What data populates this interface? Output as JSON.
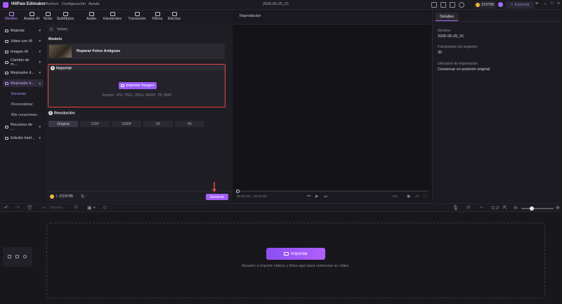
{
  "app": {
    "name": "HitPaw Edimakor",
    "date_title": "2026-05-25_01",
    "coins": "219795",
    "export_label": "Exportar"
  },
  "menu": [
    "Archivo",
    "Configuración",
    "Ayuda"
  ],
  "toolbar": [
    {
      "label": "Medios",
      "icon": "media-icon",
      "active": true
    },
    {
      "label": "Avatar AI",
      "icon": "avatar-icon"
    },
    {
      "label": "Texto",
      "icon": "text-icon"
    },
    {
      "label": "Subtítulos",
      "icon": "subtitles-icon"
    },
    {
      "label": "Audio",
      "icon": "audio-icon"
    },
    {
      "label": "Elementos",
      "icon": "elements-icon"
    },
    {
      "label": "Transición",
      "icon": "transition-icon"
    },
    {
      "label": "Filtros",
      "icon": "filters-icon"
    },
    {
      "label": "Efectos",
      "icon": "effects-icon"
    }
  ],
  "sidebar": {
    "items": [
      {
        "label": "Material"
      },
      {
        "label": "Video con IA"
      },
      {
        "label": "Imagen IA"
      },
      {
        "label": "Cambio de m..."
      },
      {
        "label": "Mejorador d..."
      },
      {
        "label": "Mejorador d...",
        "active": true
      }
    ],
    "subitems": [
      {
        "label": "Escenas",
        "active": true
      },
      {
        "label": "Personalizar"
      },
      {
        "label": "Mis creaciones"
      }
    ],
    "items_bottom": [
      {
        "label": "Recursos de ..."
      },
      {
        "label": "Edición Intel..."
      }
    ]
  },
  "panel": {
    "back_label": "Volver",
    "model_title": "Modelo",
    "model_name": "Reparar Fotos Antiguas",
    "import_num": "1",
    "import_title": "Importar",
    "import_button": "Importar Imagen",
    "support": "Soporte: JPG, PNG, JPEG, WEBP, TIF, BMP",
    "res_num": "2",
    "res_title": "Resolución",
    "resolutions": [
      "Original",
      "720P",
      "1080P",
      "2K",
      "4K"
    ],
    "credits_used": "1",
    "credits_total": "/219795",
    "generate_label": "Generar"
  },
  "player": {
    "title": "Reproductor",
    "time_current": "00:00:00",
    "time_total": "00:00:00",
    "speed": "0.5"
  },
  "details": {
    "tab": "Detalles",
    "fields": [
      {
        "label": "Nombre:",
        "value": "2026-05-25_01"
      },
      {
        "label": "Fotogramas por segundo:",
        "value": "30"
      },
      {
        "label": "Ubicación de importación:",
        "value": "Conservar en posición original"
      }
    ]
  },
  "timeline": {
    "split_label": "Separar",
    "import_label": "Importar",
    "hint": "Arrastre o importe videos y fotos aquí para comenzar su video."
  },
  "colors": {
    "accent": "#a66bff",
    "highlight_border": "#e14a45",
    "background": "#17161b"
  }
}
